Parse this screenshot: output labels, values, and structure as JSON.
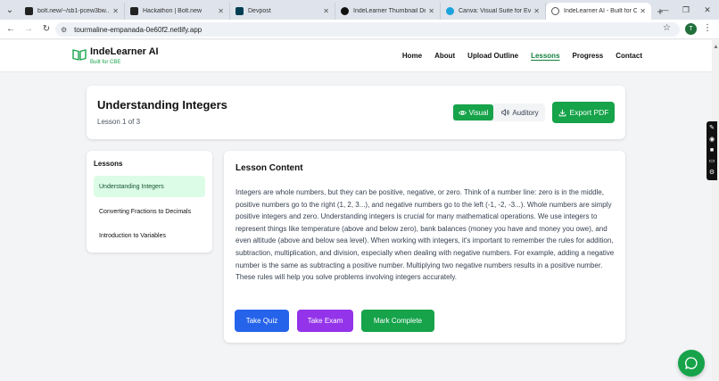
{
  "browser": {
    "tabs": [
      {
        "label": "bolt.new/~/sb1-pcew3bw...",
        "favicon_color": "#222222",
        "active": false
      },
      {
        "label": "Hackathon | Bolt.new",
        "favicon_color": "#222222",
        "active": false
      },
      {
        "label": "Devpost",
        "favicon_color": "#003e54",
        "active": false
      },
      {
        "label": "IndeLearner Thumbnail De...",
        "favicon_color": "#111111",
        "active": false
      },
      {
        "label": "Canva: Visual Suite for Eve...",
        "favicon_color": "#1aa3dd",
        "active": false
      },
      {
        "label": "IndeLearner AI - Built for C...",
        "favicon_color": "#16a34a",
        "active": true
      }
    ],
    "url": "tourmaline-empanada-0e60f2.netlify.app",
    "profile_initial": "T"
  },
  "header": {
    "brand": "IndeLearner AI",
    "tagline": "Built for CBE",
    "nav": [
      "Home",
      "About",
      "Upload Outline",
      "Lessons",
      "Progress",
      "Contact"
    ],
    "active_nav": "Lessons"
  },
  "lesson": {
    "title": "Understanding Integers",
    "counter": "Lesson 1 of 3",
    "mode_visual": "Visual",
    "mode_auditory": "Auditory",
    "export_label": "Export PDF"
  },
  "sidebar": {
    "heading": "Lessons",
    "items": [
      "Understanding Integers",
      "Converting Fractions to Decimals",
      "Introduction to Variables"
    ]
  },
  "content": {
    "heading": "Lesson Content",
    "body": "Integers are whole numbers, but they can be positive, negative, or zero. Think of a number line: zero is in the middle, positive numbers go to the right (1, 2, 3...), and negative numbers go to the left (-1, -2, -3...). Whole numbers are simply positive integers and zero. Understanding integers is crucial for many mathematical operations. We use integers to represent things like temperature (above and below zero), bank balances (money you have and money you owe), and even altitude (above and below sea level). When working with integers, it's important to remember the rules for addition, subtraction, multiplication, and division, especially when dealing with negative numbers. For example, adding a negative number is the same as subtracting a positive number. Multiplying two negative numbers results in a positive number. These rules will help you solve problems involving integers accurately.",
    "buttons": [
      {
        "label": "Take Quiz",
        "color": "#2563eb"
      },
      {
        "label": "Take Exam",
        "color": "#9333ea"
      },
      {
        "label": "Mark Complete",
        "color": "#16a34a"
      }
    ]
  },
  "colors": {
    "accent": "#16a34a",
    "active_item_bg": "#dcfce7"
  }
}
